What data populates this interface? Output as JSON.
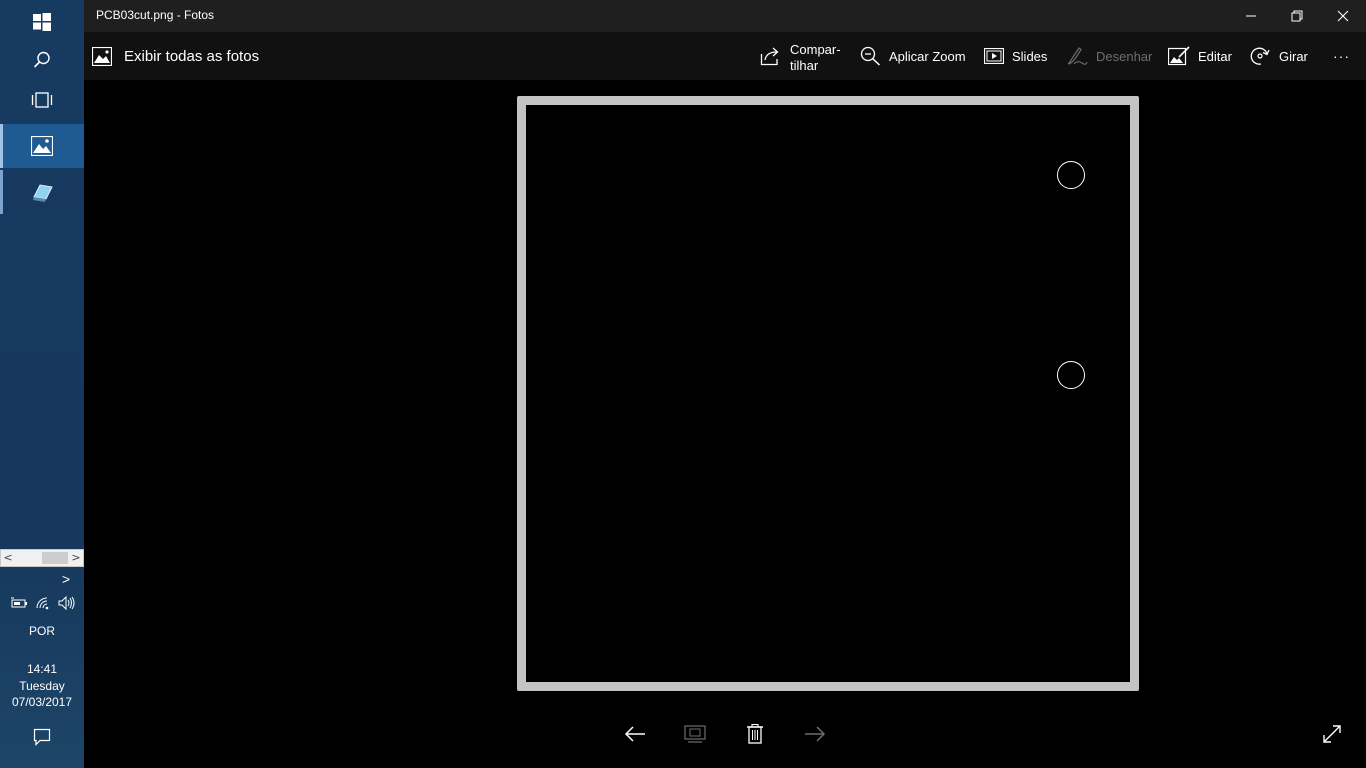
{
  "window": {
    "title": "PCB03cut.png - Fotos",
    "minimize_icon": "minimize-icon",
    "maximize_icon": "restore-icon",
    "close_icon": "close-icon"
  },
  "commandbar": {
    "back_label": "Exibir todas as fotos",
    "share_label_line1": "Compar-",
    "share_label_line2": "tilhar",
    "zoom_label": "Aplicar Zoom",
    "slides_label": "Slides",
    "draw_label": "Desenhar",
    "edit_label": "Editar",
    "rotate_label": "Girar",
    "more_label": "···"
  },
  "taskbar": {
    "language": "POR",
    "time": "14:41",
    "day": "Tuesday",
    "date": "07/03/2017",
    "scroll_left": "<",
    "scroll_right": ">",
    "tray_expand": ">"
  },
  "image": {
    "frame_color": "#c3c3c3",
    "background": "#000000",
    "holes": 2
  },
  "colors": {
    "taskbar": "#173a61",
    "active_app": "#1f5a93",
    "titlebar": "#1f1f1f",
    "commandbar": "#111111",
    "disabled": "#6e6e6e"
  }
}
